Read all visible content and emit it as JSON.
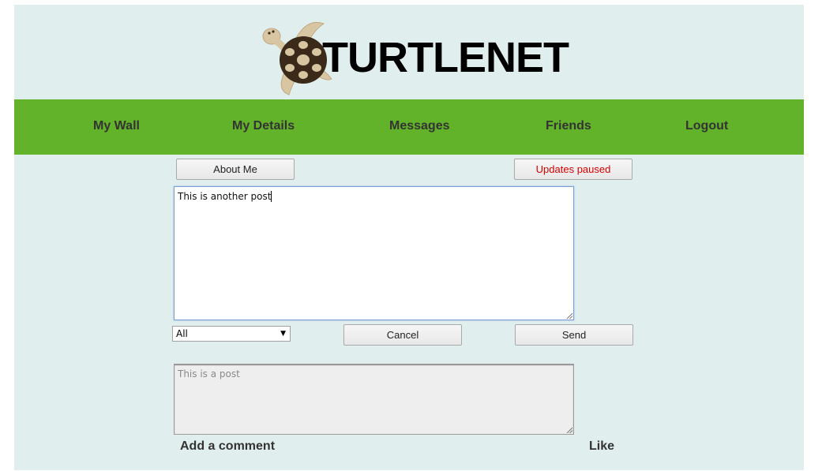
{
  "header": {
    "logo_text": "TURTLENET"
  },
  "nav": {
    "items": [
      {
        "label": "My Wall"
      },
      {
        "label": "My Details"
      },
      {
        "label": "Messages"
      },
      {
        "label": "Friends"
      },
      {
        "label": "Logout"
      }
    ]
  },
  "toolbar": {
    "about_label": "About Me",
    "updates_label": "Updates paused"
  },
  "composer": {
    "text": "This is another post",
    "audience_selected": "All",
    "cancel_label": "Cancel",
    "send_label": "Send"
  },
  "post": {
    "text": "This is a post",
    "add_comment_label": "Add a comment",
    "like_label": "Like"
  },
  "colors": {
    "background": "#e1eeee",
    "nav_green": "#63b32a",
    "updates_red": "#d40000"
  }
}
